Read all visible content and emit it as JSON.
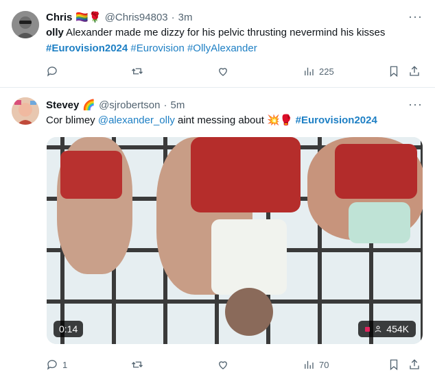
{
  "tweets": [
    {
      "name": "Chris",
      "flair": "🏳️‍🌈🌹",
      "handle": "@Chris94803",
      "time": "3m",
      "text": {
        "lead": "olly",
        "rest": " Alexander made me dizzy for his pelvic thrusting nevermind his kisses",
        "hashtags": [
          "#Eurovision2024",
          "#Eurovision",
          "#OllyAlexander"
        ]
      },
      "actions": {
        "reply": "",
        "repost": "",
        "like": "",
        "views": "225"
      }
    },
    {
      "name": "Stevey",
      "flair": "🌈",
      "handle": "@sjrobertson",
      "time": "5m",
      "text": {
        "lead": "Cor blimey ",
        "mention": "@alexander_olly",
        "rest": " aint messing about 💥🥊 ",
        "hashtag": "#Eurovision2024"
      },
      "video": {
        "duration": "0:14",
        "views": "454K"
      },
      "actions": {
        "reply": "1",
        "repost": "",
        "like": "",
        "views": "70"
      }
    }
  ],
  "icons": {
    "more": "more-icon",
    "reply": "reply-icon",
    "repost": "repost-icon",
    "like": "like-icon",
    "views": "views-icon",
    "bookmark": "bookmark-icon",
    "share": "share-icon"
  },
  "colors": {
    "link": "#1d7fc4",
    "muted": "#536471",
    "text": "#0f1419"
  }
}
